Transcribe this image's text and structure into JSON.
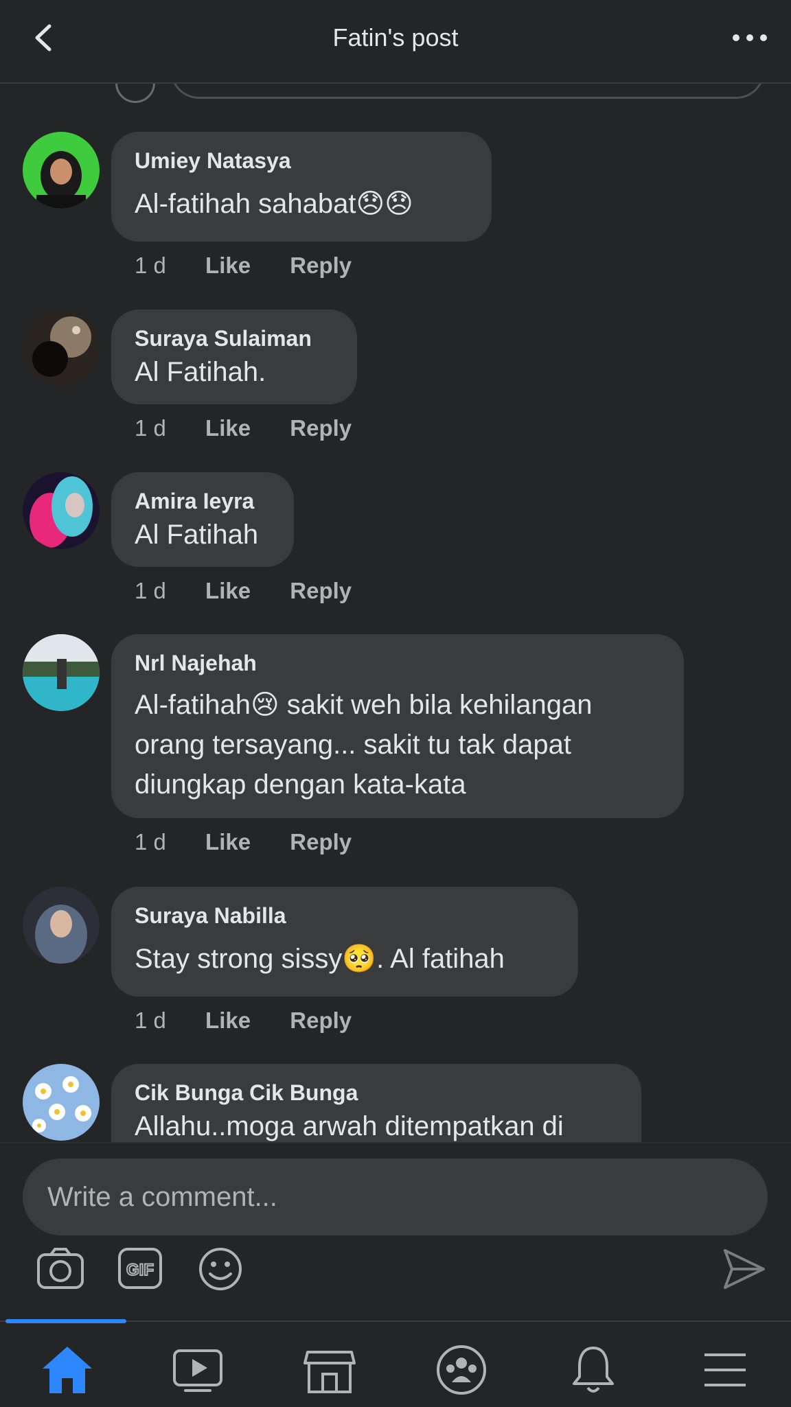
{
  "header": {
    "title": "Fatin's post"
  },
  "comments": [
    {
      "author": "Umiey Natasya",
      "text": "Al-fatihah sahabat😞😞",
      "time": "1 d",
      "like": "Like",
      "reply": "Reply"
    },
    {
      "author": "Suraya Sulaiman",
      "text": "Al Fatihah.",
      "time": "1 d",
      "like": "Like",
      "reply": "Reply"
    },
    {
      "author": "Amira Ieyra",
      "text": "Al Fatihah",
      "time": "1 d",
      "like": "Like",
      "reply": "Reply"
    },
    {
      "author": "Nrl Najehah",
      "text": "Al-fatihah😢 sakit weh bila kehilangan orang tersayang... sakit tu tak dapat diungkap dengan kata-kata",
      "time": "1 d",
      "like": "Like",
      "reply": "Reply"
    },
    {
      "author": "Suraya Nabilla",
      "text": "Stay strong sissy🥺. Al fatihah",
      "time": "1 d",
      "like": "Like",
      "reply": "Reply"
    },
    {
      "author": "Cik Bunga Cik Bunga",
      "text": "Allahu..moga arwah ditempatkan di"
    }
  ],
  "composer": {
    "placeholder": "Write a comment..."
  },
  "icons": {
    "back": "chevron-left-icon",
    "more": "more-dots-icon",
    "camera": "camera-icon",
    "gif": "gif-icon",
    "emoji": "emoji-icon",
    "send": "send-icon",
    "nav": [
      "home-icon",
      "video-icon",
      "marketplace-icon",
      "groups-icon",
      "bell-icon",
      "menu-icon"
    ]
  },
  "colors": {
    "background": "#242526",
    "bubble": "#3a3b3c",
    "accent": "#2d88ff",
    "secondary_text": "#b0b3b8"
  }
}
